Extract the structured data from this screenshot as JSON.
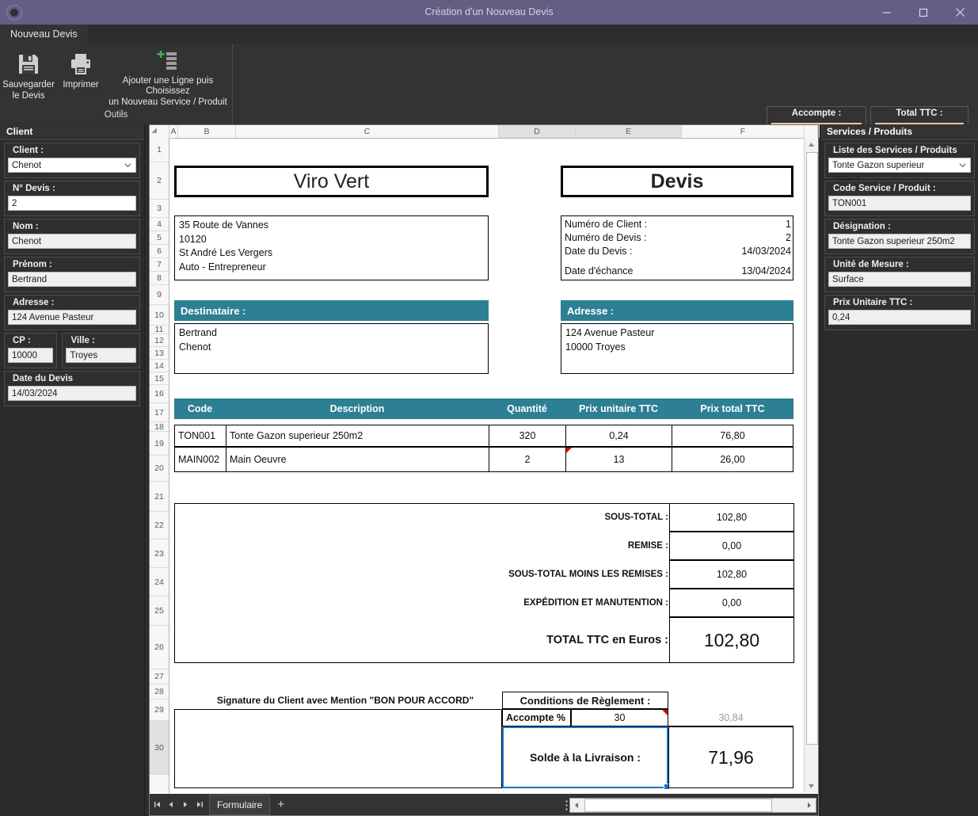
{
  "window": {
    "title": "Création d'un Nouveau Devis",
    "minimize_icon": "minimize-icon",
    "maximize_icon": "maximize-icon",
    "close_icon": "close-icon"
  },
  "ribbon": {
    "tab_label": "Nouveau Devis",
    "group_title": "Outils",
    "buttons": [
      {
        "label_line1": "Sauvegarder",
        "label_line2": "le Devis",
        "icon": "save-icon"
      },
      {
        "label_line1": "Imprimer",
        "label_line2": "",
        "icon": "print-icon"
      },
      {
        "label_line1": "Ajouter une Ligne puis Choisissez",
        "label_line2": "un Nouveau Service / Produit",
        "icon": "add-row-icon"
      }
    ]
  },
  "topboxes": [
    {
      "label": "Accompte :",
      "value": ""
    },
    {
      "label": "Total TTC :",
      "value": ""
    }
  ],
  "sidebar_left": {
    "title": "Client",
    "groups": [
      {
        "label": "Client :",
        "value": "Chenot",
        "type": "combo"
      },
      {
        "label": "N° Devis :",
        "value": "2",
        "type": "text-white"
      },
      {
        "label": "Nom :",
        "value": "Chenot",
        "type": "text"
      },
      {
        "label": "Prénom :",
        "value": "Bertrand",
        "type": "text"
      },
      {
        "label": "Adresse :",
        "value": "124 Avenue Pasteur",
        "type": "text"
      },
      {
        "label": "Date du Devis",
        "value": "14/03/2024",
        "type": "text"
      }
    ],
    "cp": {
      "label": "CP :",
      "value": "10000"
    },
    "ville": {
      "label": "Ville :",
      "value": "Troyes"
    }
  },
  "sidebar_right": {
    "title": "Services / Produits",
    "groups": [
      {
        "label": "Liste des Services / Produits",
        "value": "Tonte Gazon superieur  250m2",
        "type": "combo"
      },
      {
        "label": "Code Service / Produit :",
        "value": "TON001",
        "type": "text"
      },
      {
        "label": "Désignation :",
        "value": "Tonte Gazon superieur  250m2",
        "type": "text"
      },
      {
        "label": "Unité de Mesure :",
        "value": "Surface",
        "type": "text"
      },
      {
        "label": "Prix Unitaire TTC :",
        "value": "0,24",
        "type": "text"
      }
    ]
  },
  "sheet": {
    "columns": [
      "A",
      "B",
      "C",
      "D",
      "E",
      "F"
    ],
    "selected_columns": [
      "D",
      "E"
    ],
    "rows": [
      "1",
      "2",
      "3",
      "4",
      "5",
      "6",
      "7",
      "8",
      "9",
      "10",
      "11",
      "12",
      "13",
      "14",
      "15",
      "16",
      "17",
      "18",
      "19",
      "20",
      "21",
      "22",
      "23",
      "24",
      "25",
      "26",
      "27",
      "28",
      "29",
      "30"
    ],
    "selected_rows": [
      "30"
    ],
    "company_name": "Viro Vert",
    "doc_type": "Devis",
    "company_address": [
      "35 Route de Vannes",
      "10120",
      "St André Les Vergers",
      "Auto - Entrepreneur"
    ],
    "meta": [
      {
        "label": "Numéro de Client :",
        "value": "1"
      },
      {
        "label": "Numéro de Devis :",
        "value": "2"
      },
      {
        "label": "Date du Devis :",
        "value": "14/03/2024"
      },
      {
        "label": "Date d'échance",
        "value": "13/04/2024"
      }
    ],
    "destinataire_label": "Destinataire :",
    "destinataire_lines": [
      "Bertrand",
      "Chenot"
    ],
    "adresse_label": "Adresse :",
    "adresse_lines": [
      "124 Avenue Pasteur",
      "10000 Troyes"
    ],
    "table_headers": [
      "Code",
      "Description",
      "Quantité",
      "Prix unitaire TTC",
      "Prix total TTC"
    ],
    "table_rows": [
      {
        "code": "TON001",
        "description": "Tonte Gazon superieur 250m2",
        "quantite": "320",
        "prix_unitaire": "0,24",
        "prix_total": "76,80",
        "pu_gray": false,
        "comment": false
      },
      {
        "code": "MAIN002",
        "description": "Main Oeuvre",
        "quantite": "2",
        "prix_unitaire": "13",
        "prix_total": "26,00",
        "pu_gray": true,
        "comment": true
      }
    ],
    "totals": [
      {
        "label": "SOUS-TOTAL :",
        "value": "102,80",
        "big": false
      },
      {
        "label": "REMISE :",
        "value": "0,00",
        "big": false
      },
      {
        "label": "SOUS-TOTAL MOINS LES REMISES :",
        "value": "102,80",
        "big": false
      },
      {
        "label": "EXPÉDITION ET MANUTENTION :",
        "value": "0,00",
        "big": false
      },
      {
        "label": "TOTAL TTC en Euros :",
        "value": "102,80",
        "big": true
      }
    ],
    "signature_label": "Signature du Client avec Mention \"BON POUR ACCORD\"",
    "conditions_label": "Conditions de Règlement :",
    "accompte_pct_label": "Accompte %",
    "accompte_pct_value": "30",
    "accompte_amount": "30,84",
    "solde_label": "Solde à la Livraison :",
    "solde_value": "71,96"
  },
  "sheetbar": {
    "nav": [
      "first-sheet-icon",
      "prev-sheet-icon",
      "next-sheet-icon",
      "last-sheet-icon"
    ],
    "tabs": [
      "Formulaire"
    ],
    "add_label": "+"
  },
  "colors": {
    "titlebar": "#625e84",
    "teal": "#2d7f93",
    "tan": "#e8c79c",
    "accent_blue": "#1a73c8",
    "comment_red": "#e00000",
    "plus_green": "#3cb44b"
  }
}
